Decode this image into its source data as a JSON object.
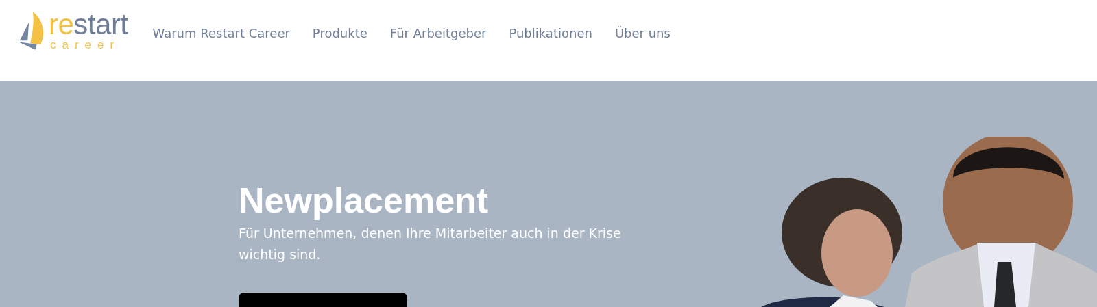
{
  "header": {
    "logo": {
      "accent": "re",
      "main": "start",
      "tagline": "career"
    },
    "nav": [
      {
        "label": "Warum Restart Career"
      },
      {
        "label": "Produkte"
      },
      {
        "label": "Für Arbeitgeber"
      },
      {
        "label": "Publikationen"
      },
      {
        "label": "Über uns"
      }
    ]
  },
  "hero": {
    "title": "Newplacement",
    "subtitle": "Für Unternehmen, denen Ihre Mitarbeiter auch in der Krise wichtig sind."
  }
}
